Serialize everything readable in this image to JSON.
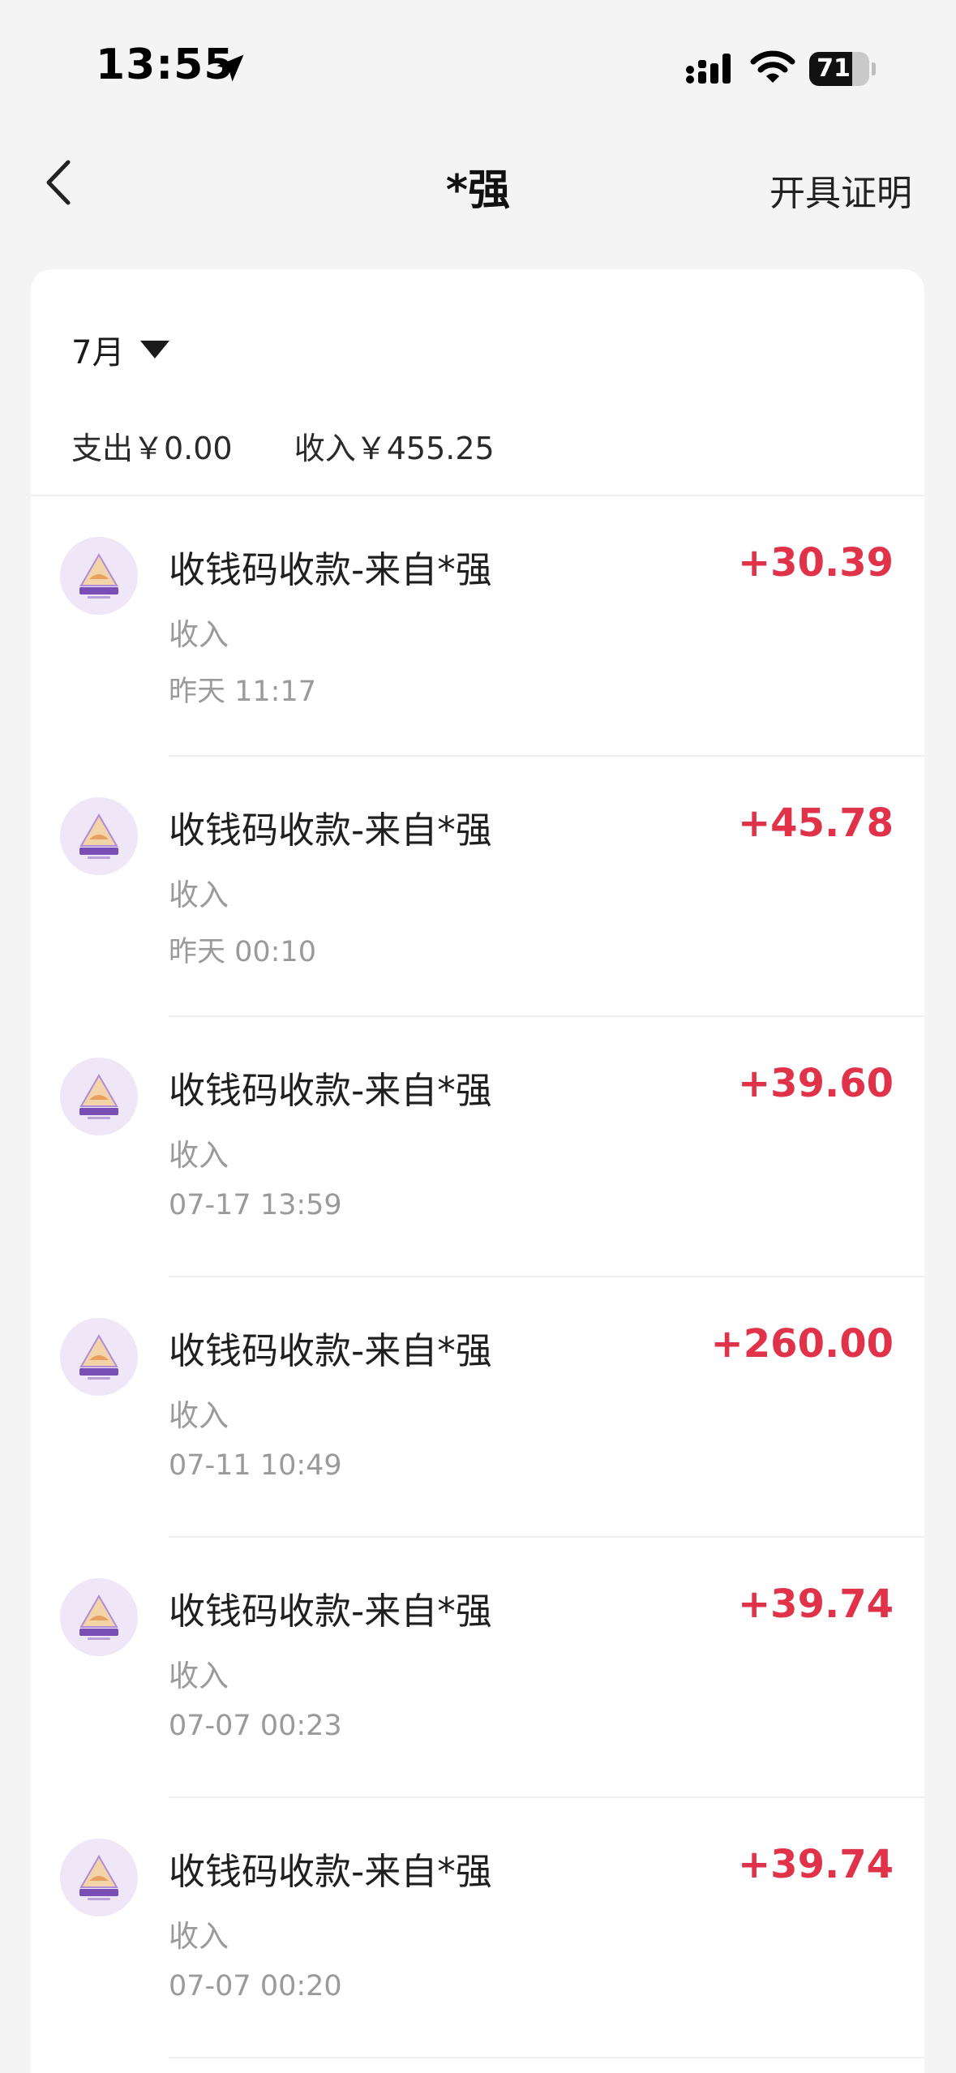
{
  "status_bar": {
    "time": "13:55",
    "battery_percent": "71",
    "battery_level": 0.71
  },
  "nav": {
    "title": "*强",
    "action_label": "开具证明"
  },
  "summary": {
    "month": "7月",
    "expense": "支出￥0.00",
    "income": "收入￥455.25"
  },
  "transactions": [
    {
      "title": "收钱码收款-来自*强",
      "type": "收入",
      "time": "昨天 11:17",
      "amount": "+30.39"
    },
    {
      "title": "收钱码收款-来自*强",
      "type": "收入",
      "time": "昨天 00:10",
      "amount": "+45.78"
    },
    {
      "title": "收钱码收款-来自*强",
      "type": "收入",
      "time": "07-17 13:59",
      "amount": "+39.60"
    },
    {
      "title": "收钱码收款-来自*强",
      "type": "收入",
      "time": "07-11 10:49",
      "amount": "+260.00"
    },
    {
      "title": "收钱码收款-来自*强",
      "type": "收入",
      "time": "07-07 00:23",
      "amount": "+39.74"
    },
    {
      "title": "收钱码收款-来自*强",
      "type": "收入",
      "time": "07-07 00:20",
      "amount": "+39.74"
    }
  ],
  "colors": {
    "income_amount": "#e0334a",
    "avatar_bg": "#efe6f8",
    "page_bg": "#f4f4f4"
  },
  "icons": {
    "back": "chevron-left-icon",
    "month_toggle": "caret-down-icon",
    "avatar": "store-logo-icon"
  }
}
